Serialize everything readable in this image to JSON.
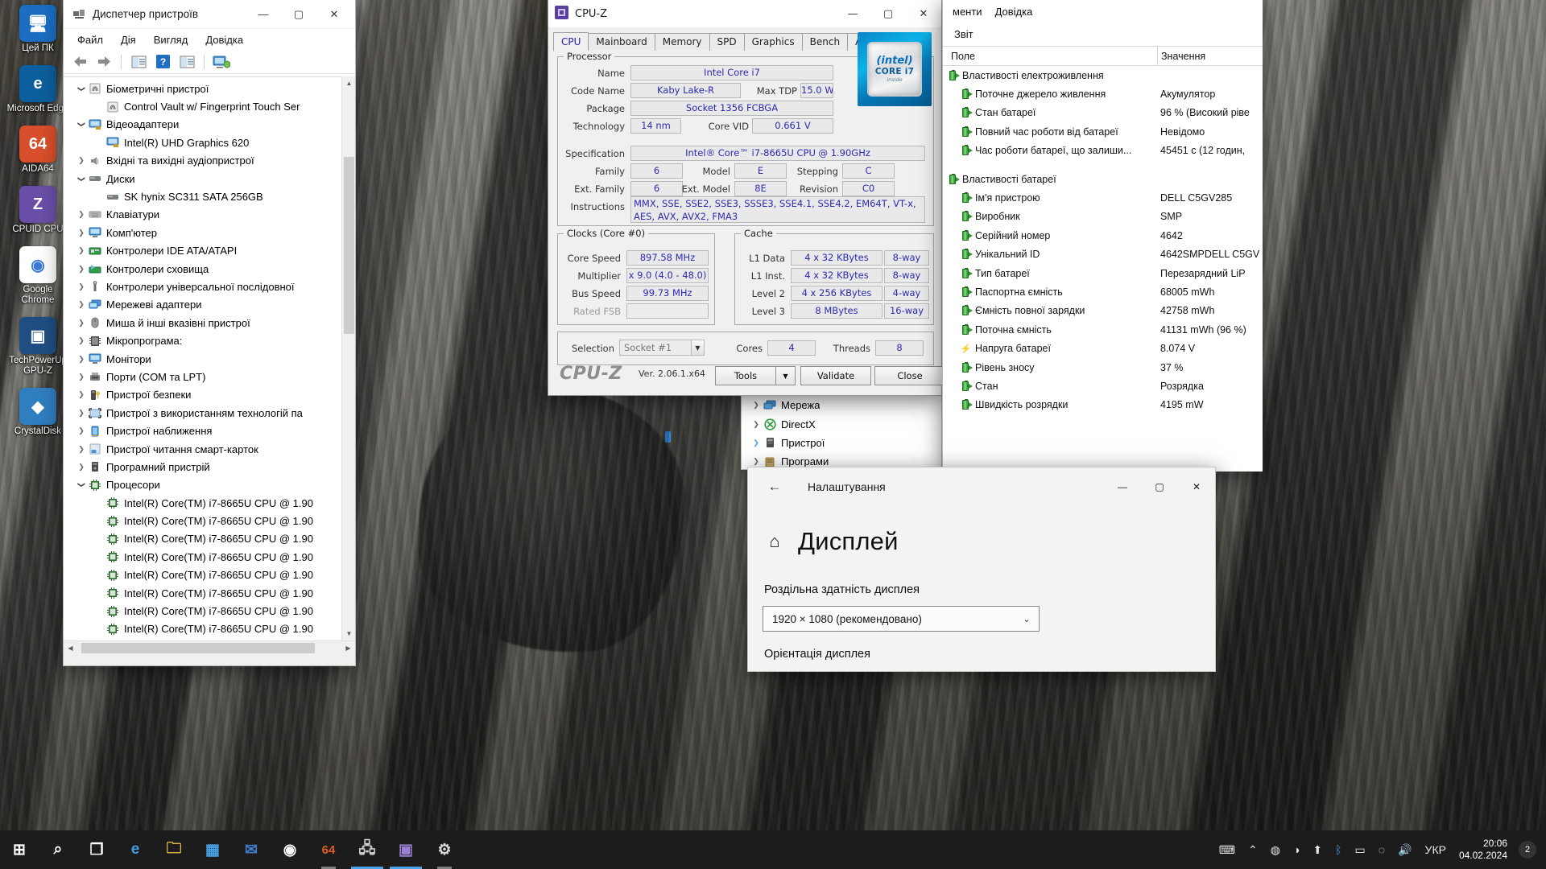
{
  "desktop": {
    "icons": [
      {
        "label": "Цей ПК",
        "glyph": "🖥",
        "color": "#1b6ec2"
      },
      {
        "label": "Microsoft Edge",
        "glyph": "e",
        "color": "#0c5f9e"
      },
      {
        "label": "AIDA64",
        "glyph": "64",
        "color": "#d94f2b"
      },
      {
        "label": "CPUID CPU",
        "glyph": "Z",
        "color": "#6a4fa8"
      },
      {
        "label": "Google Chrome",
        "glyph": "◉",
        "color": "#ffffff"
      },
      {
        "label": "TechPowerUp GPU-Z",
        "glyph": "▣",
        "color": "#1f4f82"
      },
      {
        "label": "CrystalDisk",
        "glyph": "◆",
        "color": "#2f7ec0"
      }
    ]
  },
  "device_manager": {
    "title": "Диспетчер пристроїв",
    "icon_name": "device-manager-icon",
    "window_buttons": {
      "minimize": "—",
      "maximize": "▢",
      "close": "✕"
    },
    "menu": [
      "Файл",
      "Дія",
      "Вигляд",
      "Довідка"
    ],
    "toolbar_icons": [
      "back-arrow-icon",
      "forward-arrow-icon",
      "properties-icon",
      "help-icon",
      "update-driver-icon",
      "scan-hardware-icon"
    ],
    "tree": [
      {
        "label": "Біометричні пристрої",
        "indent": 1,
        "chev": "open",
        "icon": "fingerprint-icon"
      },
      {
        "label": "Control Vault w/ Fingerprint Touch Ser",
        "indent": 2,
        "chev": "none",
        "icon": "fingerprint-icon"
      },
      {
        "label": "Відеоадаптери",
        "indent": 1,
        "chev": "open",
        "icon": "display-adapter-icon"
      },
      {
        "label": "Intel(R) UHD Graphics 620",
        "indent": 2,
        "chev": "none",
        "icon": "display-adapter-icon"
      },
      {
        "label": "Вхідні та вихідні аудіопристрої",
        "indent": 1,
        "chev": "closed",
        "icon": "audio-icon"
      },
      {
        "label": "Диски",
        "indent": 1,
        "chev": "open",
        "icon": "disk-icon"
      },
      {
        "label": "SK hynix SC311 SATA 256GB",
        "indent": 2,
        "chev": "none",
        "icon": "disk-icon"
      },
      {
        "label": "Клавіатури",
        "indent": 1,
        "chev": "closed",
        "icon": "keyboard-icon"
      },
      {
        "label": "Комп'ютер",
        "indent": 1,
        "chev": "closed",
        "icon": "computer-icon"
      },
      {
        "label": "Контролери IDE ATA/ATAPI",
        "indent": 1,
        "chev": "closed",
        "icon": "ide-controller-icon"
      },
      {
        "label": "Контролери сховища",
        "indent": 1,
        "chev": "closed",
        "icon": "storage-controller-icon"
      },
      {
        "label": "Контролери універсальної послідовної",
        "indent": 1,
        "chev": "closed",
        "icon": "usb-icon"
      },
      {
        "label": "Мережеві адаптери",
        "indent": 1,
        "chev": "closed",
        "icon": "network-adapter-icon"
      },
      {
        "label": "Миша й інші вказівні пристрої",
        "indent": 1,
        "chev": "closed",
        "icon": "mouse-icon"
      },
      {
        "label": "Мікропрограма:",
        "indent": 1,
        "chev": "closed",
        "icon": "firmware-icon"
      },
      {
        "label": "Монітори",
        "indent": 1,
        "chev": "closed",
        "icon": "monitor-icon"
      },
      {
        "label": "Порти (COM та LPT)",
        "indent": 1,
        "chev": "closed",
        "icon": "port-icon"
      },
      {
        "label": "Пристрої безпеки",
        "indent": 1,
        "chev": "closed",
        "icon": "security-device-icon"
      },
      {
        "label": "Пристрої з використанням технологій па",
        "indent": 1,
        "chev": "closed",
        "icon": "imaging-device-icon"
      },
      {
        "label": "Пристрої наближення",
        "indent": 1,
        "chev": "closed",
        "icon": "proximity-device-icon"
      },
      {
        "label": "Пристрої читання смарт-карток",
        "indent": 1,
        "chev": "closed",
        "icon": "smartcard-reader-icon"
      },
      {
        "label": "Програмний пристрій",
        "indent": 1,
        "chev": "closed",
        "icon": "software-device-icon"
      },
      {
        "label": "Процесори",
        "indent": 1,
        "chev": "open",
        "icon": "processor-icon"
      },
      {
        "label": "Intel(R) Core(TM) i7-8665U CPU @ 1.90",
        "indent": 2,
        "chev": "none",
        "icon": "processor-icon"
      },
      {
        "label": "Intel(R) Core(TM) i7-8665U CPU @ 1.90",
        "indent": 2,
        "chev": "none",
        "icon": "processor-icon"
      },
      {
        "label": "Intel(R) Core(TM) i7-8665U CPU @ 1.90",
        "indent": 2,
        "chev": "none",
        "icon": "processor-icon"
      },
      {
        "label": "Intel(R) Core(TM) i7-8665U CPU @ 1.90",
        "indent": 2,
        "chev": "none",
        "icon": "processor-icon"
      },
      {
        "label": "Intel(R) Core(TM) i7-8665U CPU @ 1.90",
        "indent": 2,
        "chev": "none",
        "icon": "processor-icon"
      },
      {
        "label": "Intel(R) Core(TM) i7-8665U CPU @ 1.90",
        "indent": 2,
        "chev": "none",
        "icon": "processor-icon"
      },
      {
        "label": "Intel(R) Core(TM) i7-8665U CPU @ 1.90",
        "indent": 2,
        "chev": "none",
        "icon": "processor-icon"
      },
      {
        "label": "Intel(R) Core(TM) i7-8665U CPU @ 1.90",
        "indent": 2,
        "chev": "none",
        "icon": "processor-icon"
      }
    ]
  },
  "cpuz": {
    "title": "CPU-Z",
    "icon_name": "cpuz-app-icon",
    "window_buttons": {
      "minimize": "—",
      "maximize": "▢",
      "close": "✕"
    },
    "tabs": [
      "CPU",
      "Mainboard",
      "Memory",
      "SPD",
      "Graphics",
      "Bench",
      "About"
    ],
    "active_tab": "CPU",
    "processor": {
      "legend": "Processor",
      "name_label": "Name",
      "name_value": "Intel Core i7",
      "codename_label": "Code Name",
      "codename_value": "Kaby Lake-R",
      "maxtdp_label": "Max TDP",
      "maxtdp_value": "15.0 W",
      "package_label": "Package",
      "package_value": "Socket 1356 FCBGA",
      "technology_label": "Technology",
      "technology_value": "14 nm",
      "corevid_label": "Core VID",
      "corevid_value": "0.661 V",
      "spec_label": "Specification",
      "spec_value": "Intel® Core™ i7-8665U CPU @ 1.90GHz",
      "family_label": "Family",
      "family_value": "6",
      "model_label": "Model",
      "model_value": "E",
      "stepping_label": "Stepping",
      "stepping_value": "C",
      "extfamily_label": "Ext. Family",
      "extfamily_value": "6",
      "extmodel_label": "Ext. Model",
      "extmodel_value": "8E",
      "revision_label": "Revision",
      "revision_value": "C0",
      "instructions_label": "Instructions",
      "instructions_value": "MMX, SSE, SSE2, SSE3, SSSE3, SSE4.1, SSE4.2, EM64T, VT-x, AES, AVX, AVX2, FMA3"
    },
    "clocks": {
      "legend": "Clocks (Core #0)",
      "core_speed_label": "Core Speed",
      "core_speed_value": "897.58 MHz",
      "multiplier_label": "Multiplier",
      "multiplier_value": "x 9.0 (4.0 - 48.0)",
      "bus_speed_label": "Bus Speed",
      "bus_speed_value": "99.73 MHz",
      "rated_fsb_label": "Rated FSB",
      "rated_fsb_value": ""
    },
    "cache": {
      "legend": "Cache",
      "rows": [
        {
          "label": "L1 Data",
          "size": "4 x 32 KBytes",
          "way": "8-way"
        },
        {
          "label": "L1 Inst.",
          "size": "4 x 32 KBytes",
          "way": "8-way"
        },
        {
          "label": "Level 2",
          "size": "4 x 256 KBytes",
          "way": "4-way"
        },
        {
          "label": "Level 3",
          "size": "8 MBytes",
          "way": "16-way"
        }
      ]
    },
    "selection": {
      "label": "Selection",
      "value": "Socket #1",
      "cores_label": "Cores",
      "cores_value": "4",
      "threads_label": "Threads",
      "threads_value": "8"
    },
    "footer": {
      "brand": "CPU-Z",
      "version": "Ver. 2.06.1.x64",
      "tools_label": "Tools",
      "dropdown_glyph": "▼",
      "validate_label": "Validate",
      "close_label": "Close"
    },
    "logo": {
      "line1": "(intel)",
      "line2": "CORE i7",
      "line3": "inside"
    }
  },
  "aida": {
    "menu": [
      "менти",
      "Довідка"
    ],
    "report_label": "Звіт",
    "columns": {
      "field": "Поле",
      "value": "Значення"
    },
    "rows": [
      {
        "type": "group",
        "icon": "battery-icon",
        "field": "Властивості електроживлення",
        "value": ""
      },
      {
        "type": "child",
        "icon": "battery-icon",
        "field": "Поточне джерело живлення",
        "value": "Акумулятор"
      },
      {
        "type": "child",
        "icon": "battery-icon",
        "field": "Стан батареї",
        "value": "96 % (Високий ріве"
      },
      {
        "type": "child",
        "icon": "battery-icon",
        "field": "Повний час роботи від батареї",
        "value": "Невідомо"
      },
      {
        "type": "child",
        "icon": "battery-icon",
        "field": "Час роботи батареї, що залиши...",
        "value": "45451 с (12 годин,"
      },
      {
        "type": "spacer",
        "icon": "",
        "field": "",
        "value": ""
      },
      {
        "type": "group",
        "icon": "battery-icon",
        "field": "Властивості батареї",
        "value": ""
      },
      {
        "type": "child",
        "icon": "battery-icon",
        "field": "Ім'я пристрою",
        "value": "DELL C5GV285"
      },
      {
        "type": "child",
        "icon": "battery-icon",
        "field": "Виробник",
        "value": "SMP"
      },
      {
        "type": "child",
        "icon": "battery-icon",
        "field": "Серійний номер",
        "value": "4642"
      },
      {
        "type": "child",
        "icon": "battery-icon",
        "field": "Унікальний ID",
        "value": "4642SMPDELL C5GV"
      },
      {
        "type": "child",
        "icon": "battery-icon",
        "field": "Тип батареї",
        "value": "Перезарядний LiP"
      },
      {
        "type": "child",
        "icon": "battery-icon",
        "field": "Паспортна ємність",
        "value": "68005 mWh"
      },
      {
        "type": "child",
        "icon": "battery-icon",
        "field": "Ємність повної зарядки",
        "value": "42758 mWh"
      },
      {
        "type": "child",
        "icon": "battery-icon",
        "field": "Поточна ємність",
        "value": "41131 mWh  (96 %)"
      },
      {
        "type": "child",
        "icon": "bolt-icon",
        "field": "Напруга батареї",
        "value": "8.074 V"
      },
      {
        "type": "child",
        "icon": "battery-icon",
        "field": "Рівень зносу",
        "value": "37 %"
      },
      {
        "type": "child",
        "icon": "battery-icon",
        "field": "Стан",
        "value": "Розрядка"
      },
      {
        "type": "child",
        "icon": "battery-icon",
        "field": "Швидкість розрядки",
        "value": "4195 mW"
      }
    ]
  },
  "aida_tree": {
    "rows": [
      {
        "label": "Мережа",
        "icon": "network-icon",
        "chev": "closed"
      },
      {
        "label": "DirectX",
        "icon": "directx-icon",
        "chev": "closed"
      },
      {
        "label": "Пристрої",
        "icon": "devices-icon",
        "chev": "closed-highlight"
      },
      {
        "label": "Програми",
        "icon": "programs-icon",
        "chev": "closed"
      }
    ]
  },
  "settings": {
    "title": "Налаштування",
    "back_glyph": "←",
    "window_buttons": {
      "minimize": "—",
      "maximize": "▢",
      "close": "✕"
    },
    "home_icon": "⌂",
    "page_title": "Дисплей",
    "resolution_section": "Роздільна здатність дисплея",
    "resolution_value": "1920 × 1080 (рекомендовано)",
    "resolution_arrow": "⌄",
    "orientation_section": "Орієнтація дисплея"
  },
  "taskbar": {
    "items": [
      {
        "name": "start-button",
        "glyph": "⊞",
        "color": "#ffffff",
        "state": "none"
      },
      {
        "name": "search-button",
        "glyph": "⌕",
        "color": "#ffffff",
        "state": "none"
      },
      {
        "name": "task-view-button",
        "glyph": "❐",
        "color": "#ffffff",
        "state": "none"
      },
      {
        "name": "edge-taskbar-icon",
        "glyph": "e",
        "color": "#3ea0dc",
        "state": "none"
      },
      {
        "name": "file-explorer-taskbar-icon",
        "glyph": "🗀",
        "color": "#f0c24b",
        "state": "none"
      },
      {
        "name": "store-taskbar-icon",
        "glyph": "▦",
        "color": "#4aa3e8",
        "state": "none"
      },
      {
        "name": "mail-taskbar-icon",
        "glyph": "✉",
        "color": "#3e7fd0",
        "state": "none"
      },
      {
        "name": "chrome-taskbar-icon",
        "glyph": "◉",
        "color": "#ffffff",
        "state": "none"
      },
      {
        "name": "aida64-taskbar-icon",
        "glyph": "64",
        "color": "#e05a2b",
        "state": "running"
      },
      {
        "name": "device-manager-taskbar-icon",
        "glyph": "🖧",
        "color": "#cfcfcf",
        "state": "active"
      },
      {
        "name": "cpuz-taskbar-icon",
        "glyph": "▣",
        "color": "#9a7fd4",
        "state": "active"
      },
      {
        "name": "settings-taskbar-icon",
        "glyph": "⚙",
        "color": "#dadada",
        "state": "running"
      }
    ],
    "tray": {
      "keyboard_glyph": "⌨",
      "chevron_glyph": "⌃",
      "icons": [
        "◍",
        "◑",
        "⬆",
        "ᛒ",
        "▭",
        "◌"
      ],
      "volume_glyph": "🔊",
      "language": "УКР",
      "time": "20:06",
      "date": "04.02.2024",
      "notification_count": "2"
    }
  }
}
